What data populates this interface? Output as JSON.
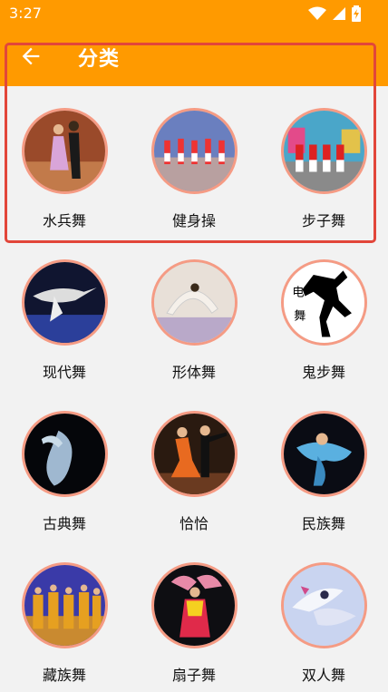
{
  "status_bar": {
    "time": "3:27"
  },
  "app_bar": {
    "title": "分类"
  },
  "categories": [
    {
      "label": "水兵舞",
      "icon": "dance-couple-photo",
      "bg": "#9a4a2a"
    },
    {
      "label": "健身操",
      "icon": "group-aerobics-photo",
      "bg": "#6a7fbf"
    },
    {
      "label": "步子舞",
      "icon": "group-step-dance-photo",
      "bg": "#4aa6c9"
    },
    {
      "label": "现代舞",
      "icon": "modern-dance-photo",
      "bg": "#101530"
    },
    {
      "label": "形体舞",
      "icon": "body-dance-photo",
      "bg": "#e8e0d8"
    },
    {
      "label": "鬼步舞",
      "icon": "shuffle-dance-silhouette",
      "bg": "#ffffff"
    },
    {
      "label": "古典舞",
      "icon": "classical-dance-photo",
      "bg": "#05060a"
    },
    {
      "label": "恰恰",
      "icon": "chacha-dance-photo",
      "bg": "#2a1a10"
    },
    {
      "label": "民族舞",
      "icon": "ethnic-dance-photo",
      "bg": "#0a0c14"
    },
    {
      "label": "藏族舞",
      "icon": "tibetan-dance-photo",
      "bg": "#3a3aa8"
    },
    {
      "label": "扇子舞",
      "icon": "fan-dance-photo",
      "bg": "#0e0e12"
    },
    {
      "label": "双人舞",
      "icon": "duet-dance-photo",
      "bg": "#c9d4f0"
    }
  ]
}
